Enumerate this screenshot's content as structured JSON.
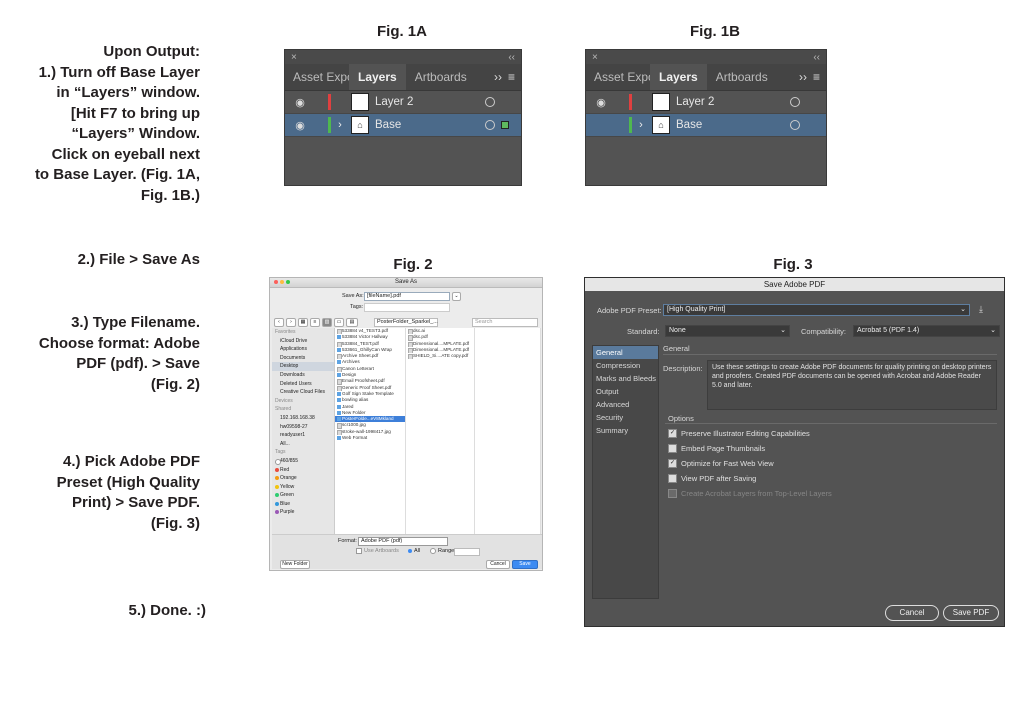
{
  "steps": [
    {
      "text": "Upon Output:\n1.) Turn off Base Layer\nin “Layers” window.\n[Hit F7 to bring up\n“Layers” Window.\nClick on eyeball next\nto  Base Layer. (Fig. 1A,\nFig. 1B.)"
    },
    {
      "text": "2.) File > Save As"
    },
    {
      "text": "3.) Type Filename.\nChoose format: Adobe\nPDF (pdf). > Save\n(Fig. 2)"
    },
    {
      "text": "4.) Pick Adobe PDF\nPreset (High Quality\nPrint) > Save PDF.\n(Fig. 3)"
    },
    {
      "text": "5.) Done. :)"
    }
  ],
  "figures": {
    "fig1a": "Fig. 1A",
    "fig1b": "Fig. 1B",
    "fig2": "Fig. 2",
    "fig3": "Fig. 3"
  },
  "layers_panel": {
    "close": "×",
    "collapse": "‹‹",
    "tabs": [
      "Asset Expo",
      "Layers",
      "Artboards"
    ],
    "more": "››",
    "menu": "≡",
    "layers": [
      {
        "name": "Layer 2",
        "color": "#e04040"
      },
      {
        "name": "Base",
        "color": "#4fb84f"
      }
    ],
    "eye": "◉",
    "expand": "›"
  },
  "save_as": {
    "title": "Save As",
    "save_as_label": "Save As:",
    "filename": "[fileName].pdf",
    "tags_label": "Tags:",
    "location": "PosterFolder_Sparkel_...",
    "search": "Search",
    "sidebar": [
      {
        "label": "Favorites",
        "head": true
      },
      {
        "label": "iCloud Drive"
      },
      {
        "label": "Applications"
      },
      {
        "label": "Documents"
      },
      {
        "label": "Desktop",
        "sel": true
      },
      {
        "label": "Downloads"
      },
      {
        "label": "Deleted Users"
      },
      {
        "label": "Creative Cloud Files"
      },
      {
        "label": "Devices",
        "head": true
      },
      {
        "label": "Shared",
        "head": true
      },
      {
        "label": "192.168.168.38"
      },
      {
        "label": "hw09598-27"
      },
      {
        "label": "readyuser1"
      },
      {
        "label": "All..."
      },
      {
        "label": "Tags",
        "head": true
      },
      {
        "label": "460/855",
        "tag": "#ffffff"
      },
      {
        "label": "Red",
        "tag": "#e84c3d"
      },
      {
        "label": "Orange",
        "tag": "#f39c12"
      },
      {
        "label": "Yellow",
        "tag": "#f1c40f"
      },
      {
        "label": "Green",
        "tag": "#2ecc71"
      },
      {
        "label": "Blue",
        "tag": "#3498db"
      },
      {
        "label": "Purple",
        "tag": "#9b59b6"
      }
    ],
    "col1": [
      {
        "label": "533884 v4_TEST3.pdf",
        "doc": true
      },
      {
        "label": "533884 Victor Hallway"
      },
      {
        "label": "533884_TEST.pdf",
        "doc": true
      },
      {
        "label": "533661_GhillyCan Wrap"
      },
      {
        "label": "Archive Sheet.pdf",
        "doc": true
      },
      {
        "label": "Archives"
      },
      {
        "label": "Canon Letterart",
        "doc": true
      },
      {
        "label": "Design"
      },
      {
        "label": "Email Proofsheet.pdf",
        "doc": true
      },
      {
        "label": "Generic Proof Sheet.pdf",
        "doc": true
      },
      {
        "label": "Golf Sign Stake Template"
      },
      {
        "label": "bowling alias"
      },
      {
        "label": "Jared"
      },
      {
        "label": "New Folder"
      },
      {
        "label": "PosterFolde...eV8Mkland",
        "sel": true
      },
      {
        "label": "scr1000.jpg",
        "doc": true
      },
      {
        "label": "stroke-wall-1998417.jpg",
        "doc": true
      },
      {
        "label": "Web Format"
      }
    ],
    "col2": [
      {
        "label": "dsc.ai",
        "doc": true
      },
      {
        "label": "dsc.pdf",
        "doc": true
      },
      {
        "label": "Dimensional....MPLATE.pdf",
        "doc": true
      },
      {
        "label": "Dimensional....MPLATE.pdf",
        "doc": true
      },
      {
        "label": "SHIELD_Si....ATE copy.pdf",
        "doc": true
      }
    ],
    "format_label": "Format:",
    "format_value": "Adobe PDF (pdf)",
    "use_artboards": "Use Artboards",
    "all": "All",
    "range": "Range:",
    "new_folder": "New Folder",
    "cancel": "Cancel",
    "save": "Save"
  },
  "pdf_dialog": {
    "title": "Save Adobe PDF",
    "preset_label": "Adobe PDF Preset:",
    "preset_value": "[High Quality Print]",
    "standard_label": "Standard:",
    "standard_value": "None",
    "compat_label": "Compatibility:",
    "compat_value": "Acrobat 5 (PDF 1.4)",
    "nav": [
      "General",
      "Compression",
      "Marks and Bleeds",
      "Output",
      "Advanced",
      "Security",
      "Summary"
    ],
    "section_title": "General",
    "description_label": "Description:",
    "description": "Use these settings to create Adobe PDF documents for quality printing on desktop printers and proofers.  Created PDF documents can be opened with Acrobat and Adobe Reader 5.0 and later.",
    "options_title": "Options",
    "options": [
      {
        "label": "Preserve Illustrator Editing Capabilities",
        "checked": true
      },
      {
        "label": "Embed Page Thumbnails",
        "checked": false
      },
      {
        "label": "Optimize for Fast Web View",
        "checked": true
      },
      {
        "label": "View PDF after Saving",
        "checked": false
      },
      {
        "label": "Create Acrobat Layers from Top-Level Layers",
        "checked": false,
        "disabled": true
      }
    ],
    "cancel": "Cancel",
    "save": "Save PDF"
  }
}
